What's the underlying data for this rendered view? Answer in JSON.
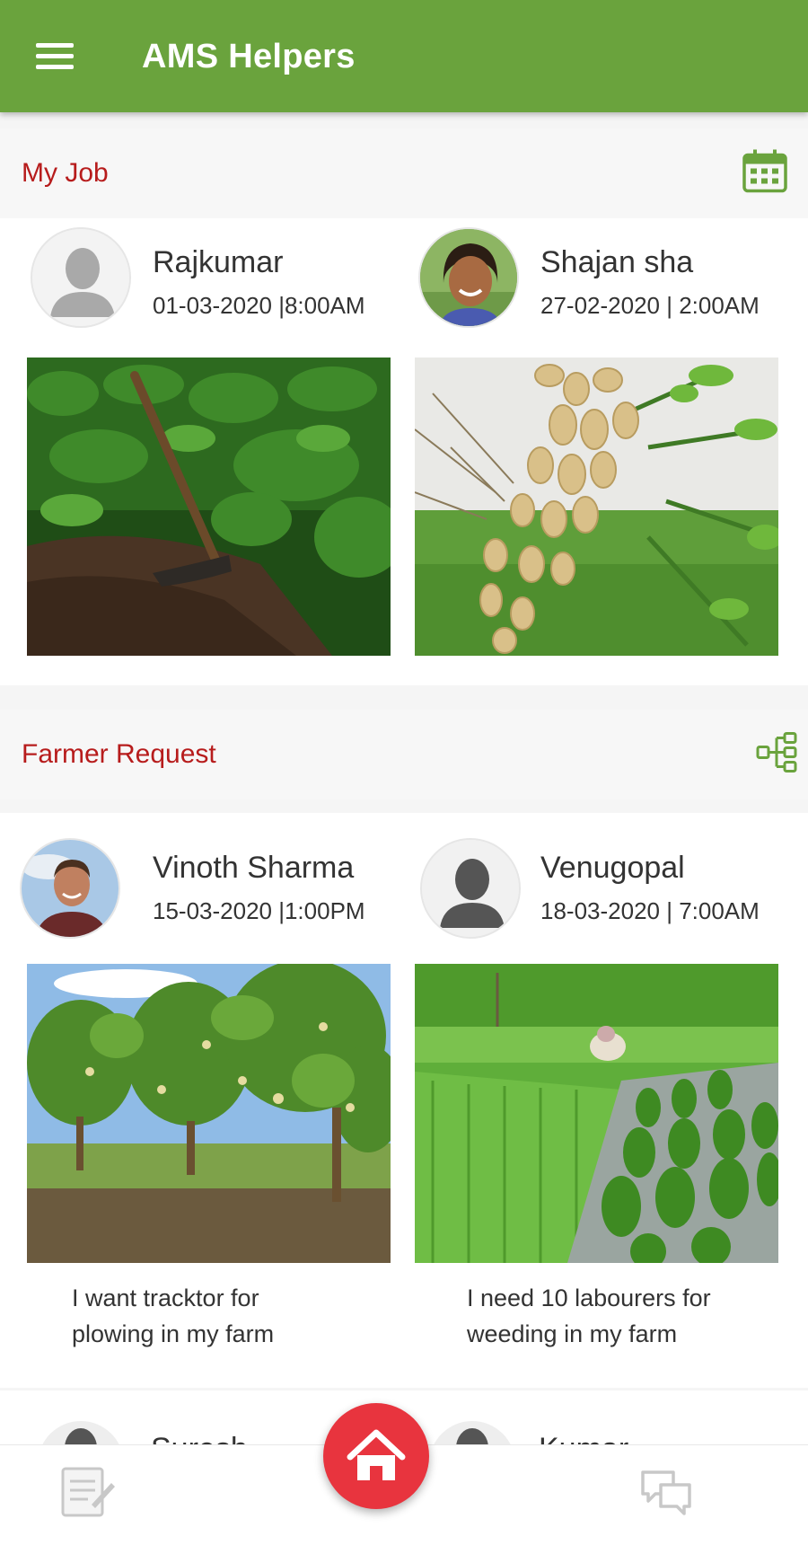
{
  "app": {
    "title": "AMS Helpers"
  },
  "my_job": {
    "title": "My Job",
    "jobs": [
      {
        "name": "Rajkumar",
        "datetime": "01-03-2020 |8:00AM"
      },
      {
        "name": "Shajan  sha",
        "datetime": "27-02-2020 | 2:00AM"
      }
    ]
  },
  "farmer_request": {
    "title": "Farmer Request",
    "requests": [
      {
        "name": "Vinoth Sharma",
        "datetime": "15-03-2020 |1:00PM",
        "caption_line1": "I want tracktor for",
        "caption_line2": "plowing in my farm"
      },
      {
        "name": "Venugopal",
        "datetime": "18-03-2020 | 7:00AM",
        "caption_line1": "I need 10 labourers for",
        "caption_line2": "weeding  in my farm"
      }
    ],
    "partial_next": [
      {
        "name": "Suresh"
      },
      {
        "name": "Kumar"
      }
    ]
  },
  "colors": {
    "primary": "#6aa33d",
    "accent_red": "#b71c1c",
    "fab": "#e8343e"
  },
  "icons": {
    "menu": "hamburger-menu-icon",
    "calendar": "calendar-icon",
    "hierarchy": "hierarchy-icon",
    "home": "home-icon",
    "document": "document-icon",
    "chat": "chat-icon"
  }
}
